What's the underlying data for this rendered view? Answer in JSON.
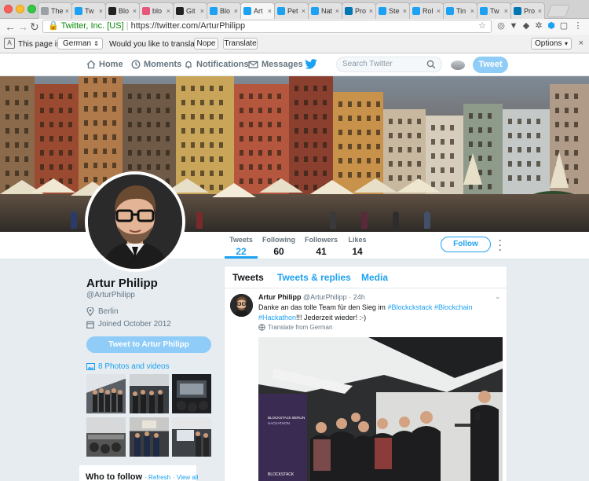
{
  "browser": {
    "tabs": [
      {
        "label": "The",
        "icon": "doc-icon",
        "color": "#9aa0a6",
        "active": false
      },
      {
        "label": "Tw",
        "icon": "twitter-icon",
        "color": "#1da1f2",
        "active": false
      },
      {
        "label": "Blo",
        "icon": "blog-icon",
        "color": "#222222",
        "active": false
      },
      {
        "label": "blo",
        "icon": "s-icon",
        "color": "#e8577a",
        "active": false
      },
      {
        "label": "Git",
        "icon": "github-icon",
        "color": "#222222",
        "active": false
      },
      {
        "label": "Blo",
        "icon": "twitter-icon",
        "color": "#1da1f2",
        "active": false
      },
      {
        "label": "Art",
        "icon": "twitter-icon",
        "color": "#1da1f2",
        "active": true
      },
      {
        "label": "Pet",
        "icon": "twitter-icon",
        "color": "#1da1f2",
        "active": false
      },
      {
        "label": "Nat",
        "icon": "twitter-icon",
        "color": "#1da1f2",
        "active": false
      },
      {
        "label": "Pro",
        "icon": "linkedin-icon",
        "color": "#0077b5",
        "active": false
      },
      {
        "label": "Ste",
        "icon": "twitter-icon",
        "color": "#1da1f2",
        "active": false
      },
      {
        "label": "Rol",
        "icon": "twitter-icon",
        "color": "#1da1f2",
        "active": false
      },
      {
        "label": "Tin",
        "icon": "twitter-icon",
        "color": "#1da1f2",
        "active": false
      },
      {
        "label": "Tw",
        "icon": "twitter-icon",
        "color": "#1da1f2",
        "active": false
      },
      {
        "label": "Pro",
        "icon": "linkedin-icon",
        "color": "#0077b5",
        "active": false
      }
    ],
    "tab_close": "×",
    "back": "←",
    "forward": "→",
    "reload": "↻",
    "ev_name": "Twitter, Inc. [US]",
    "separator": "|",
    "url": "https://twitter.com/ArturPhilipp"
  },
  "translate_bar": {
    "page_is_in": "This page is in",
    "language": "German",
    "question": "Would you like to translate it?",
    "nope": "Nope",
    "translate": "Translate",
    "options": "Options",
    "close": "×"
  },
  "twitter_nav": {
    "home": "Home",
    "moments": "Moments",
    "notifications": "Notifications",
    "messages": "Messages",
    "search_placeholder": "Search Twitter",
    "tweet": "Tweet"
  },
  "profile_nav": {
    "stats": [
      {
        "label": "Tweets",
        "value": "22"
      },
      {
        "label": "Following",
        "value": "60"
      },
      {
        "label": "Followers",
        "value": "41"
      },
      {
        "label": "Likes",
        "value": "14"
      }
    ],
    "follow": "Follow"
  },
  "profile": {
    "name": "Artur Philipp",
    "handle": "@ArturPhilipp",
    "location": "Berlin",
    "joined": "Joined October 2012",
    "tweet_to": "Tweet to Artur Philipp",
    "photos_videos": "8 Photos and videos"
  },
  "who_to_follow": {
    "title": "Who to follow",
    "refresh": "· Refresh",
    "view_all": "· View all"
  },
  "timeline": {
    "tabs": {
      "tweets": "Tweets",
      "replies": "Tweets & replies",
      "media": "Media"
    },
    "tweet": {
      "name": "Artur Philipp",
      "handle": "@ArturPhilipp",
      "time": "· 24h",
      "text_a": "Danke an das tolle Team für den Sieg im ",
      "tag1": "#Blockckstack",
      "space": " ",
      "tag2": "#Blockchain",
      "tag3": "#Hackathon",
      "text_b": "!!! Jederzeit wieder! :-)",
      "translate": "Translate from German",
      "banner_line1": "BLOCKSTACK BERLIN",
      "banner_line2": "HACKATHON",
      "banner_brand": "BLOCKSTACK"
    }
  }
}
